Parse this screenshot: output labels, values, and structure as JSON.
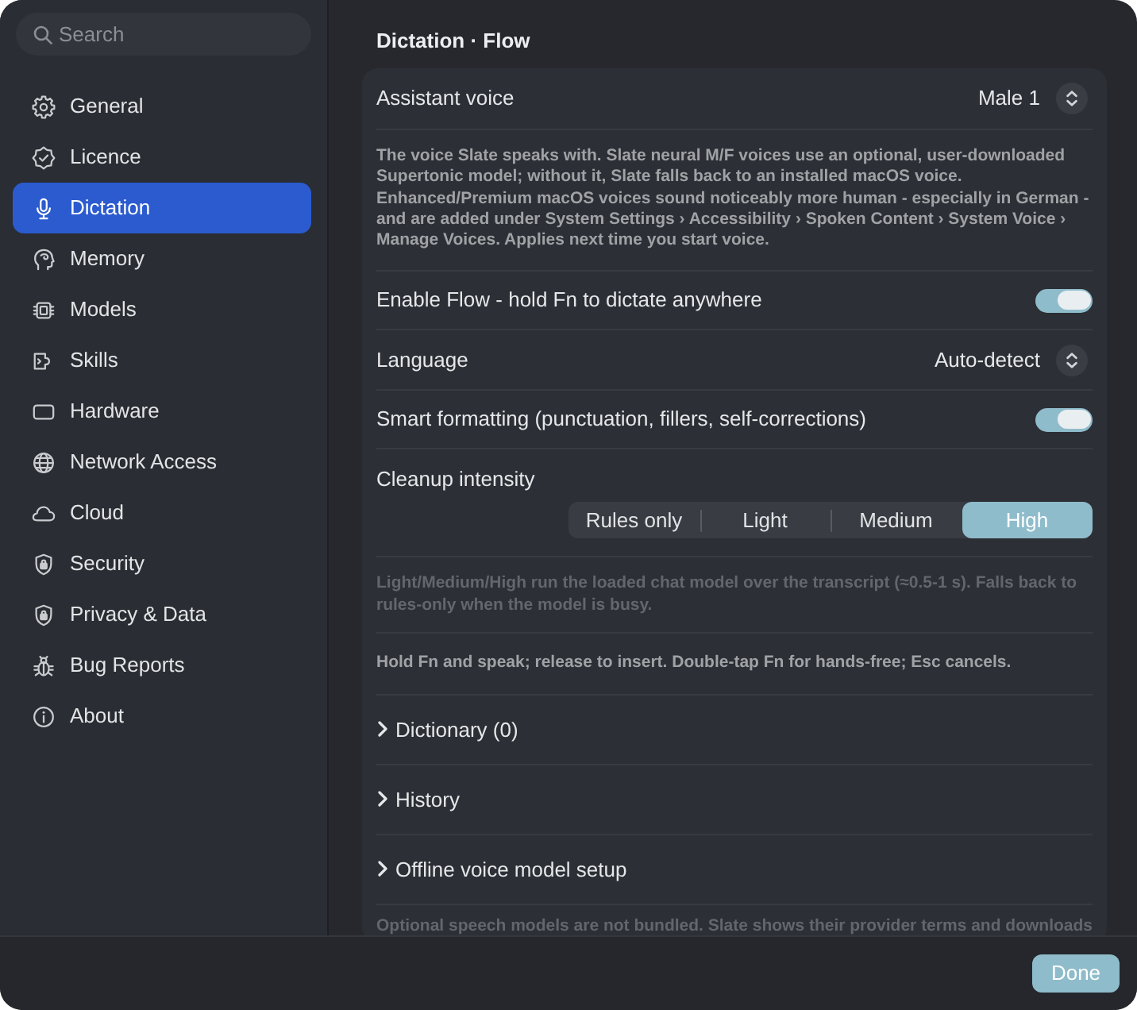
{
  "sidebar": {
    "search": {
      "placeholder": "Search"
    },
    "items": [
      {
        "label": "General",
        "selected": false
      },
      {
        "label": "Licence",
        "selected": false
      },
      {
        "label": "Dictation",
        "selected": true
      },
      {
        "label": "Memory",
        "selected": false
      },
      {
        "label": "Models",
        "selected": false
      },
      {
        "label": "Skills",
        "selected": false
      },
      {
        "label": "Hardware",
        "selected": false
      },
      {
        "label": "Network Access",
        "selected": false
      },
      {
        "label": "Cloud",
        "selected": false
      },
      {
        "label": "Security",
        "selected": false
      },
      {
        "label": "Privacy & Data",
        "selected": false
      },
      {
        "label": "Bug Reports",
        "selected": false
      },
      {
        "label": "About",
        "selected": false
      }
    ]
  },
  "page": {
    "title": "Dictation · Flow"
  },
  "settings": [
    {
      "kind": "select",
      "label": "Assistant voice",
      "value": "Male 1"
    },
    {
      "kind": "note",
      "text": "The voice Slate speaks with. Slate neural M/F voices use an optional, user-downloaded Supertonic model; without it, Slate falls back to an installed macOS voice. Enhanced/Premium macOS voices sound noticeably more human - especially in German - and are added under System Settings › Accessibility › Spoken Content › System Voice › Manage Voices. Applies next time you start voice."
    },
    {
      "kind": "toggle",
      "label": "Enable Flow - hold Fn to dictate anywhere",
      "on": true
    },
    {
      "kind": "select",
      "label": "Language",
      "value": "Auto-detect"
    },
    {
      "kind": "toggle",
      "label": "Smart formatting (punctuation, fillers, self-corrections)",
      "on": true
    },
    {
      "kind": "segmented",
      "label": "Cleanup intensity",
      "options": [
        {
          "label": "Rules only",
          "selected": false
        },
        {
          "label": "Light",
          "selected": false
        },
        {
          "label": "Medium",
          "selected": false
        },
        {
          "label": "High",
          "selected": true
        }
      ]
    },
    {
      "kind": "hint",
      "text": "Light/Medium/High run the loaded chat model over the transcript (≈0.5-1 s). Falls back to rules-only when the model is busy."
    },
    {
      "kind": "note",
      "text": "Hold Fn and speak; release to insert. Double-tap Fn for hands-free; Esc cancels."
    },
    {
      "kind": "disclosure",
      "label": "Dictionary (0)",
      "expanded": false
    },
    {
      "kind": "disclosure",
      "label": "History",
      "expanded": false
    },
    {
      "kind": "disclosure",
      "label": "Offline voice model setup",
      "expanded": false
    },
    {
      "kind": "hint",
      "text": "Optional speech models are not bundled. Slate shows their provider terms and downloads"
    }
  ],
  "footer": {
    "button": "Done"
  }
}
